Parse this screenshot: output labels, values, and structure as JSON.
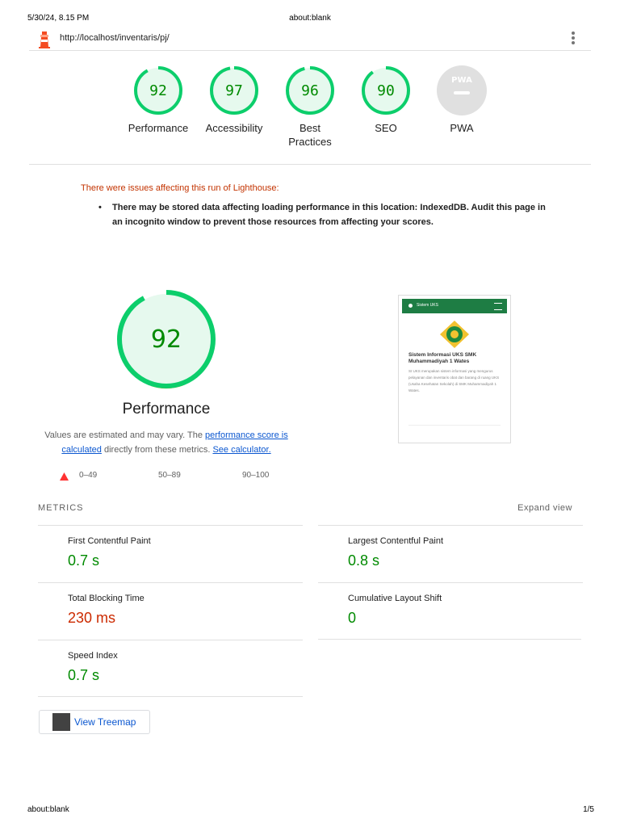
{
  "print_header": {
    "datetime": "5/30/24, 8.15 PM",
    "title": "about:blank"
  },
  "url_bar": {
    "url": "http://localhost/inventaris/pj/"
  },
  "categories": [
    {
      "score": "92",
      "label": "Performance",
      "value": 92,
      "color": "#0cce6b"
    },
    {
      "score": "97",
      "label": "Accessibility",
      "value": 97,
      "color": "#0cce6b"
    },
    {
      "score": "96",
      "label": "Best Practices",
      "value": 96,
      "color": "#0cce6b"
    },
    {
      "score": "90",
      "label": "SEO",
      "value": 90,
      "color": "#0cce6b"
    },
    {
      "score": "PWA",
      "label": "PWA",
      "value": null,
      "color": "#bdbdbd"
    }
  ],
  "warning": {
    "title": "There were issues affecting this run of Lighthouse:",
    "items": [
      "There may be stored data affecting loading performance in this location: IndexedDB. Audit this page in an incognito window to prevent those resources from affecting your scores."
    ]
  },
  "performance": {
    "score": "92",
    "value": 92,
    "title": "Performance",
    "desc_prefix": "Values are estimated and may vary. The ",
    "desc_link1": "performance score is calculated",
    "desc_mid": " directly from these metrics. ",
    "desc_link2": "See calculator."
  },
  "legend": {
    "fail": "0–49",
    "average": "50–89",
    "pass": "90–100"
  },
  "screenshot": {
    "bar_title": "Sistem UKS",
    "heading": "Sistem Informasi UKS SMK Muhammadiyah 1 Wates",
    "body": "SI UKS merupakan sistem informasi yang mengurus pelayanan dan inventaris obat dan barang di ruang UKS (Usaha Kesehatan Sekolah) di SMK Muhammadiyah 1 Wates."
  },
  "metrics": {
    "header": "METRICS",
    "expand": "Expand view",
    "items": [
      {
        "label": "First Contentful Paint",
        "value": "0.7 s",
        "status": "pass"
      },
      {
        "label": "Largest Contentful Paint",
        "value": "0.8 s",
        "status": "pass"
      },
      {
        "label": "Total Blocking Time",
        "value": "230 ms",
        "status": "fail"
      },
      {
        "label": "Cumulative Layout Shift",
        "value": "0",
        "status": "pass"
      },
      {
        "label": "Speed Index",
        "value": "0.7 s",
        "status": "pass"
      }
    ]
  },
  "treemap_button": {
    "label": "View Treemap",
    "icon": "treemap-icon"
  },
  "footer": {
    "left": "about:blank",
    "right": "1/5"
  },
  "colors": {
    "pass": "#0cce6b",
    "pass_text": "#008a00",
    "fail": "#cc2a00",
    "link": "#0b57d0"
  }
}
